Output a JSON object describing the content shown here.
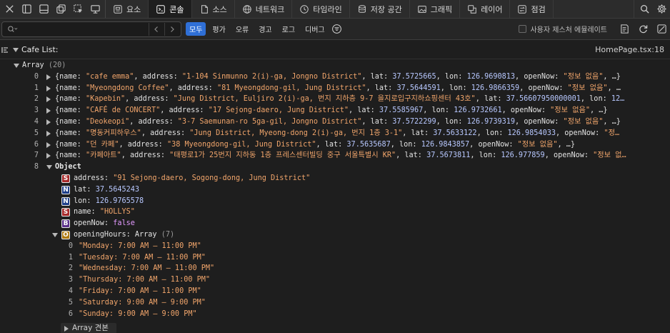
{
  "toolbar": {
    "left_icons": [
      "close-icon",
      "dock-left-icon",
      "dock-bottom-icon",
      "undock-icon",
      "element-picker-icon",
      "device-icon"
    ],
    "tabs": [
      {
        "icon": "elements-icon",
        "label": "요소",
        "active": false
      },
      {
        "icon": "console-icon",
        "label": "콘솔",
        "active": true
      },
      {
        "icon": "sources-icon",
        "label": "소스",
        "active": false
      },
      {
        "icon": "network-icon",
        "label": "네트워크",
        "active": false
      },
      {
        "icon": "timeline-icon",
        "label": "타임라인",
        "active": false
      },
      {
        "icon": "storage-icon",
        "label": "저장 공간",
        "active": false
      },
      {
        "icon": "graphics-icon",
        "label": "그래픽",
        "active": false
      },
      {
        "icon": "layers-icon",
        "label": "레이어",
        "active": false
      },
      {
        "icon": "audit-icon",
        "label": "점검",
        "active": false
      }
    ],
    "right_icons": [
      "search-icon",
      "settings-icon"
    ]
  },
  "filter_bar": {
    "search_placeholder": "",
    "filters": [
      {
        "label": "모두",
        "selected": true
      },
      {
        "label": "평가",
        "selected": false
      },
      {
        "label": "오류",
        "selected": false
      },
      {
        "label": "경고",
        "selected": false
      },
      {
        "label": "로그",
        "selected": false
      },
      {
        "label": "디버그",
        "selected": false
      }
    ],
    "checkbox_label": "사용자 제스처 에뮬레이트",
    "checkbox_checked": false
  },
  "console": {
    "log_label": "Cafe List:",
    "source": "HomePage.tsx:18",
    "array_label": "Array",
    "array_count": "(20)",
    "items": [
      {
        "index": "0",
        "name": "\"cafe emma\"",
        "address": "\"1-104 Sinmunno 2(i)-ga, Jongno District\"",
        "lat": "37.5725665",
        "lon": "126.9690813",
        "tail_key": "openNow",
        "tail_val": "\"정보 없음\"",
        "end": ", …}"
      },
      {
        "index": "1",
        "name": "\"Myeongdong Coffee\"",
        "address": "\"81 Myeongdong-gil, Jung District\"",
        "lat": "37.5644591",
        "lon": "126.9866359",
        "tail_key": "openNow",
        "tail_val": "\"정보 없음\"",
        "end": ", …"
      },
      {
        "index": "2",
        "name": "\"Kapebin\"",
        "address": "\"Jung District, Euljiro 2(i)-ga, 번지 지하층 9-7 을지로입구지하쇼핑센터 43호\"",
        "lat": "37.56607950000001",
        "lon": "12…",
        "tail_key": "",
        "tail_val": "",
        "end": ""
      },
      {
        "index": "3",
        "name": "\"CAFÉ de CONCERT\"",
        "address": "\"17 Sejong-daero, Jung District\"",
        "lat": "37.5585967",
        "lon": "126.9732661",
        "tail_key": "openNow",
        "tail_val": "\"정보 없음\"",
        "end": ", …}"
      },
      {
        "index": "4",
        "name": "\"Deokeopi\"",
        "address": "\"3-7 Saemunan-ro 5ga-gil, Jongno District\"",
        "lat": "37.5722299",
        "lon": "126.9739319",
        "tail_key": "openNow",
        "tail_val": "\"정보 없음\"",
        "end": ", …}"
      },
      {
        "index": "5",
        "name": "\"명동커피하우스\"",
        "address": "\"Jung District, Myeong-dong 2(i)-ga, 번지 1층 3-1\"",
        "lat": "37.5633122",
        "lon": "126.9854033",
        "tail_key": "openNow",
        "tail_val": "\"정…",
        "end": ""
      },
      {
        "index": "6",
        "name": "\"던 카페\"",
        "address": "\"38 Myeongdong-gil, Jung District\"",
        "lat": "37.5635687",
        "lon": "126.9843857",
        "tail_key": "openNow",
        "tail_val": "\"정보 없음\"",
        "end": ", …}"
      },
      {
        "index": "7",
        "name": "\"카페아트\"",
        "address": "\"태평로1가 25번지 지하동 1층 프레스센터빌딩 중구 서울특별시 KR\"",
        "lat": "37.5673811",
        "lon": "126.977859",
        "tail_key": "openNow",
        "tail_val": "\"정보 없…",
        "end": ""
      }
    ],
    "object_index": "8",
    "object_label": "Object",
    "props": [
      {
        "badge": "S",
        "key": "address:",
        "value": "\"91 Sejong-daero, Sogong-dong, Jung District\"",
        "kind": "str"
      },
      {
        "badge": "N",
        "key": "lat:",
        "value": "37.5645243",
        "kind": "num"
      },
      {
        "badge": "N",
        "key": "lon:",
        "value": "126.9765578",
        "kind": "num"
      },
      {
        "badge": "S",
        "key": "name:",
        "value": "\"HOLLYS\"",
        "kind": "str"
      },
      {
        "badge": "B",
        "key": "openNow:",
        "value": "false",
        "kind": "bool"
      }
    ],
    "opening_hours": {
      "badge": "O",
      "key": "openingHours:",
      "type": "Array",
      "count": "(7)",
      "entries": [
        {
          "index": "0",
          "value": "\"Monday: 7:00 AM – 11:00 PM\""
        },
        {
          "index": "1",
          "value": "\"Tuesday: 7:00 AM – 11:00 PM\""
        },
        {
          "index": "2",
          "value": "\"Wednesday: 7:00 AM – 11:00 PM\""
        },
        {
          "index": "3",
          "value": "\"Thursday: 7:00 AM – 11:00 PM\""
        },
        {
          "index": "4",
          "value": "\"Friday: 7:00 AM – 11:00 PM\""
        },
        {
          "index": "5",
          "value": "\"Saturday: 9:00 AM – 9:00 PM\""
        },
        {
          "index": "6",
          "value": "\"Sunday: 9:00 AM – 9:00 PM\""
        }
      ]
    },
    "prototype_label": "Array 견본"
  },
  "colors": {
    "background": "#1e1e1e",
    "string": "#f1a56b",
    "number": "#b8c8ff",
    "accent": "#2f6fd6",
    "badge_string": "#a82a2a",
    "badge_number": "#1f3f8a",
    "badge_boolean": "#5a2f8a",
    "badge_object": "#b07a10"
  }
}
